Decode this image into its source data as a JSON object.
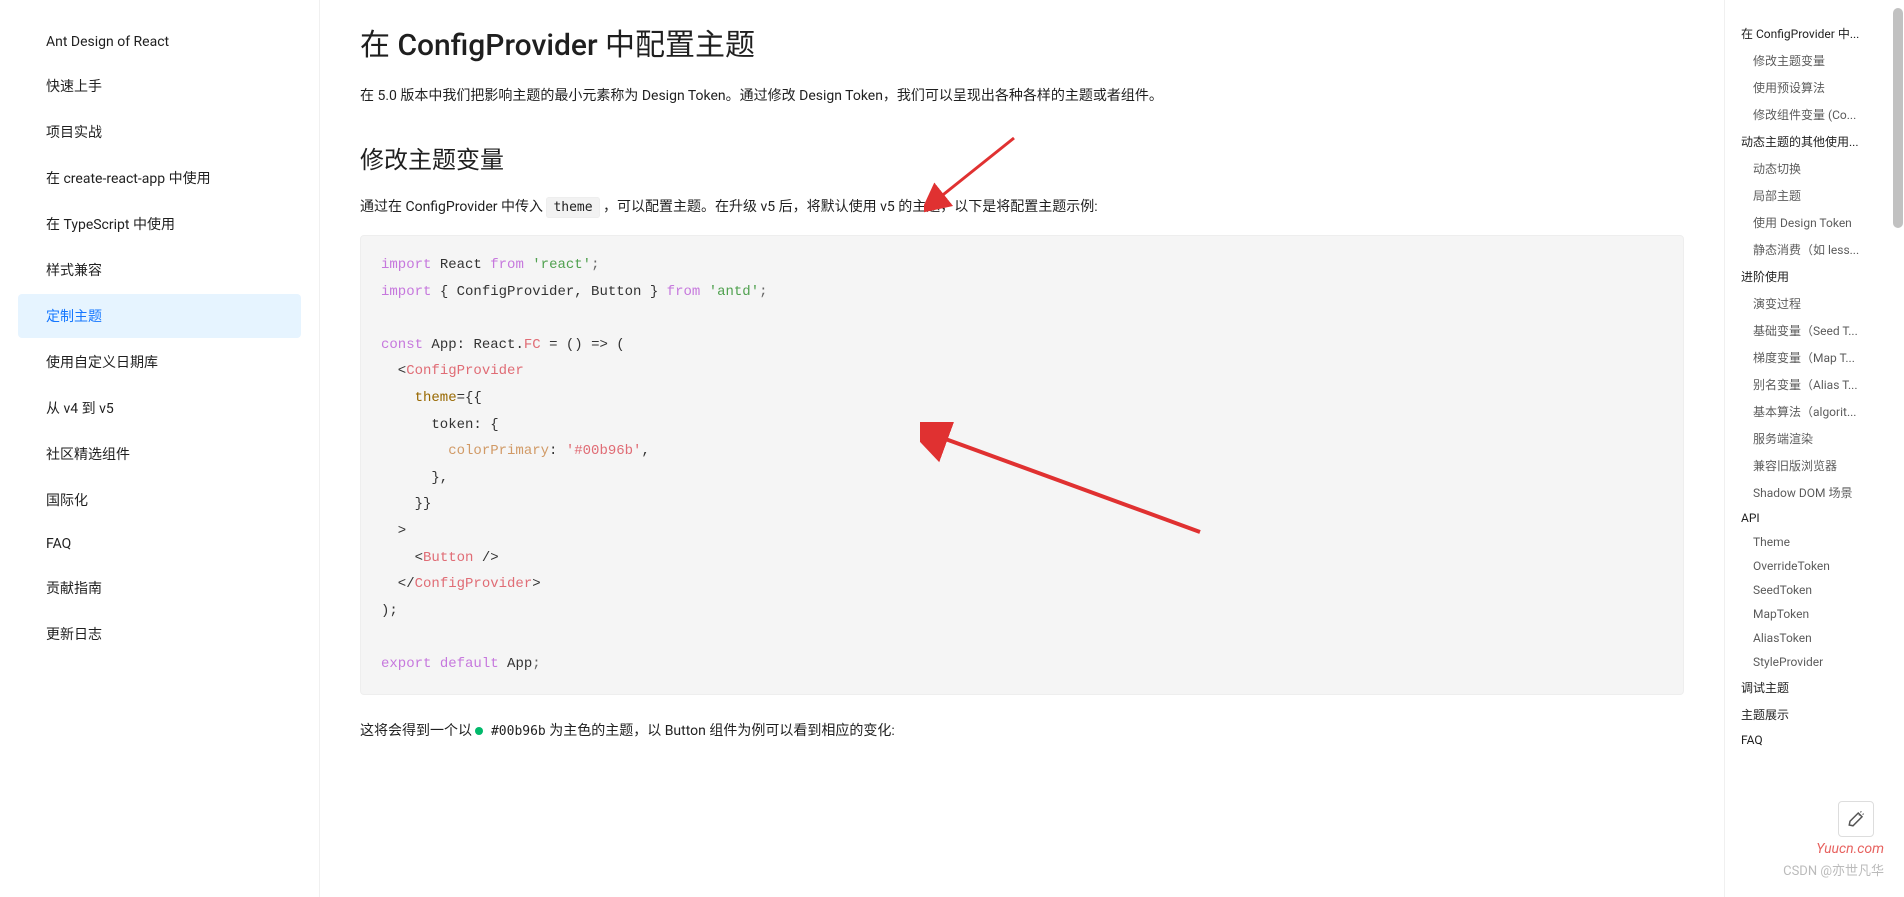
{
  "sidebar": {
    "items": [
      "Ant Design of React",
      "快速上手",
      "项目实战",
      "在 create-react-app 中使用",
      "在 TypeScript 中使用",
      "样式兼容",
      "定制主题",
      "使用自定义日期库",
      "从 v4 到 v5",
      "社区精选组件",
      "国际化",
      "FAQ",
      "贡献指南",
      "更新日志"
    ],
    "activeIndex": 6
  },
  "main": {
    "h1": "在 ConfigProvider 中配置主题",
    "p1": "在 5.0 版本中我们把影响主题的最小元素称为 Design Token。通过修改 Design Token，我们可以呈现出各种各样的主题或者组件。",
    "h2": "修改主题变量",
    "p2_before": "通过在 ConfigProvider 中传入 ",
    "p2_code": "theme",
    "p2_after": " ，可以配置主题。在升级 v5 后，将默认使用 v5 的主题，以下是将配置主题示例:",
    "code": {
      "l1_import": "import",
      "l1_react": "React",
      "l1_from": "from",
      "l1_str": "'react'",
      "l1_end": ";",
      "l2_import": "import",
      "l2_brace": "{ ConfigProvider, Button }",
      "l2_from": "from",
      "l2_str": "'antd'",
      "l2_end": ";",
      "l3_const": "const",
      "l3_app": "App",
      "l3_colon": ": ",
      "l3_react": "React",
      "l3_dot": ".",
      "l3_fc": "FC",
      "l3_eq": " = () => (",
      "l4": "  <",
      "l4_tag": "ConfigProvider",
      "l5_attr": "    theme",
      "l5_eq": "={{",
      "l6": "      token: {",
      "l7_key": "        colorPrimary",
      "l7_colon": ": ",
      "l7_val": "'#00b96b'",
      "l7_end": ",",
      "l8": "      },",
      "l9": "    }}",
      "l10": "  >",
      "l11_open": "    <",
      "l11_tag": "Button",
      "l11_close": " />",
      "l12_open": "  </",
      "l12_tag": "ConfigProvider",
      "l12_close": ">",
      "l13": ");",
      "l14_export": "export",
      "l14_default": "default",
      "l14_app": "App",
      "l14_end": ";"
    },
    "p3_before": "这将会得到一个以 ",
    "p3_hash": "#00b96b",
    "p3_after": " 为主色的主题，以 Button 组件为例可以看到相应的变化:"
  },
  "toc": {
    "items": [
      {
        "level": 1,
        "text": "在 ConfigProvider 中..."
      },
      {
        "level": 2,
        "text": "修改主题变量"
      },
      {
        "level": 2,
        "text": "使用预设算法"
      },
      {
        "level": 2,
        "text": "修改组件变量 (Co..."
      },
      {
        "level": 1,
        "text": "动态主题的其他使用..."
      },
      {
        "level": 2,
        "text": "动态切换"
      },
      {
        "level": 2,
        "text": "局部主题"
      },
      {
        "level": 2,
        "text": "使用 Design Token"
      },
      {
        "level": 2,
        "text": "静态消费（如 less..."
      },
      {
        "level": 1,
        "text": "进阶使用"
      },
      {
        "level": 2,
        "text": "演变过程"
      },
      {
        "level": 2,
        "text": "基础变量（Seed T..."
      },
      {
        "level": 2,
        "text": "梯度变量（Map T..."
      },
      {
        "level": 2,
        "text": "别名变量（Alias T..."
      },
      {
        "level": 2,
        "text": "基本算法（algorit..."
      },
      {
        "level": 2,
        "text": "服务端渲染"
      },
      {
        "level": 2,
        "text": "兼容旧版浏览器"
      },
      {
        "level": 2,
        "text": "Shadow DOM 场景"
      },
      {
        "level": 1,
        "text": "API"
      },
      {
        "level": 2,
        "text": "Theme"
      },
      {
        "level": 2,
        "text": "OverrideToken"
      },
      {
        "level": 2,
        "text": "SeedToken"
      },
      {
        "level": 2,
        "text": "MapToken"
      },
      {
        "level": 2,
        "text": "AliasToken"
      },
      {
        "level": 2,
        "text": "StyleProvider"
      },
      {
        "level": 1,
        "text": "调试主题"
      },
      {
        "level": 1,
        "text": "主题展示"
      },
      {
        "level": 1,
        "text": "FAQ"
      }
    ]
  },
  "watermark": "Yuucn.com",
  "csdn": "CSDN @亦世凡华"
}
